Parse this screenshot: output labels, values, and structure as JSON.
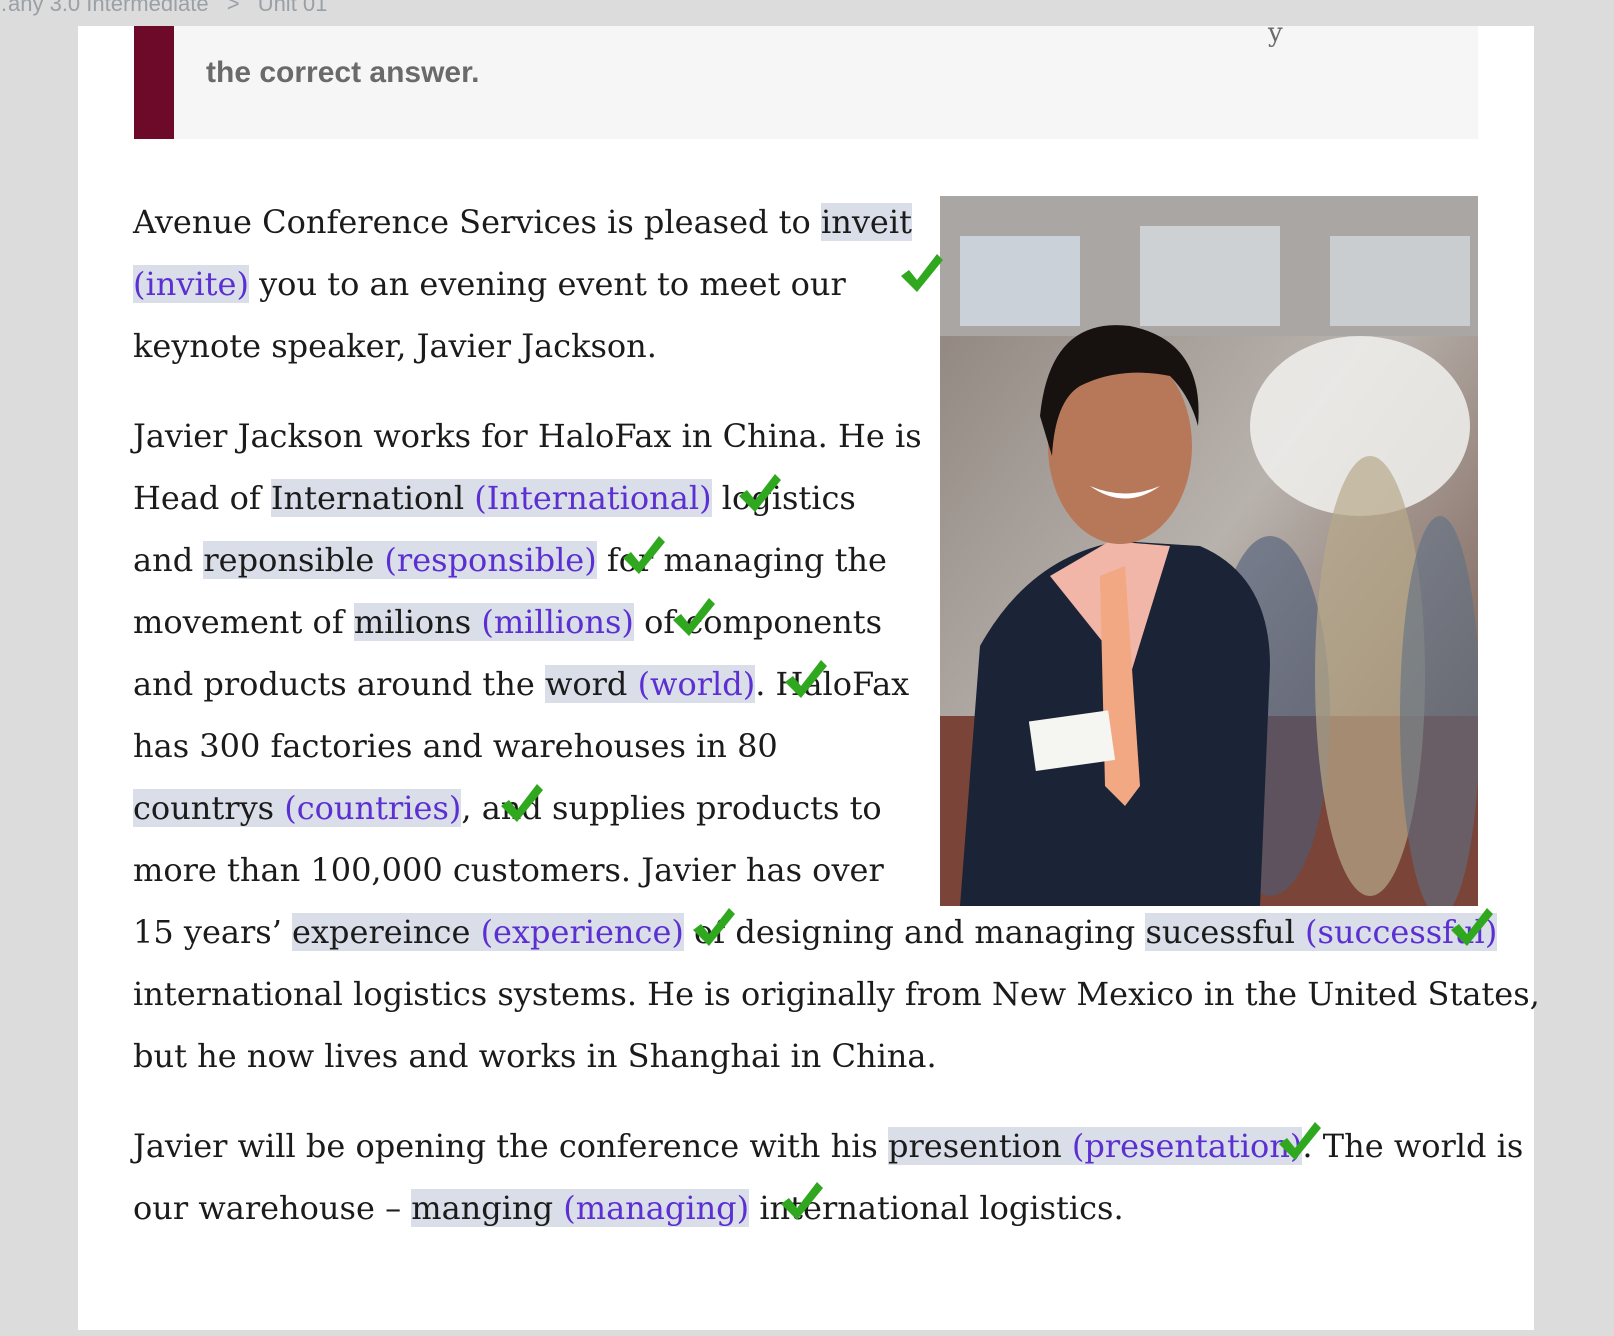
{
  "breadcrumb": {
    "course": "…any 3.0 Intermediate",
    "separator": ">",
    "unit": "Unit 01"
  },
  "instruction": {
    "text": "the correct answer.",
    "partial": "y"
  },
  "colors": {
    "accent": "#6d0a2a",
    "correction": "#5c2fd2",
    "highlight": "#d9dee8",
    "check": "#2fa81f"
  },
  "photo": {
    "icon": "photo-speaker"
  },
  "paragraphs": [
    {
      "lines": [
        {
          "pre": "Avenue Conference Services is pleased to ",
          "error": "inveit",
          "correction": ""
        },
        {
          "pre": "",
          "error": "",
          "correction": "(invite)",
          "post": " you to an evening event to meet our"
        },
        {
          "pre": "keynote speaker, Javier Jackson."
        }
      ]
    },
    {
      "lines": [
        {
          "pre": "Javier Jackson works for HaloFax in China. He is"
        },
        {
          "pre": "Head of ",
          "error": "Internationl",
          "correction": "(International)",
          "post": " logistics"
        },
        {
          "pre": "and ",
          "error": "reponsible",
          "correction": "(responsible)",
          "post": " for managing the"
        },
        {
          "pre": "movement of ",
          "error": "milions",
          "correction": "(millions)",
          "post": " of components"
        },
        {
          "pre": "and products around the ",
          "error": "word",
          "correction": "(world)",
          "post": ". HaloFax"
        },
        {
          "pre": "has 300 factories and warehouses in 80"
        },
        {
          "pre": "",
          "error": "countrys",
          "correction": "(countries)",
          "post": ", and supplies products to"
        },
        {
          "pre": "more than 100,000 customers. Javier has over"
        },
        {
          "pre": "15 years’ ",
          "error": "expereince",
          "correction": "(experience)",
          "post": " of designing and managing ",
          "error2": "sucessful",
          "correction2": "(successful)"
        },
        {
          "pre": "international logistics systems. He is originally from New Mexico in the United States,"
        },
        {
          "pre": "but he now lives and works in Shanghai in China."
        }
      ]
    },
    {
      "lines": [
        {
          "pre": "Javier will be opening the conference with his ",
          "error": "presention",
          "correction": "(presentation)",
          "post": ". The world is"
        },
        {
          "pre": "our warehouse – ",
          "error": "manging",
          "correction": "(managing)",
          "post": " international logistics."
        }
      ]
    }
  ],
  "check_icon": "checkmark-icon"
}
